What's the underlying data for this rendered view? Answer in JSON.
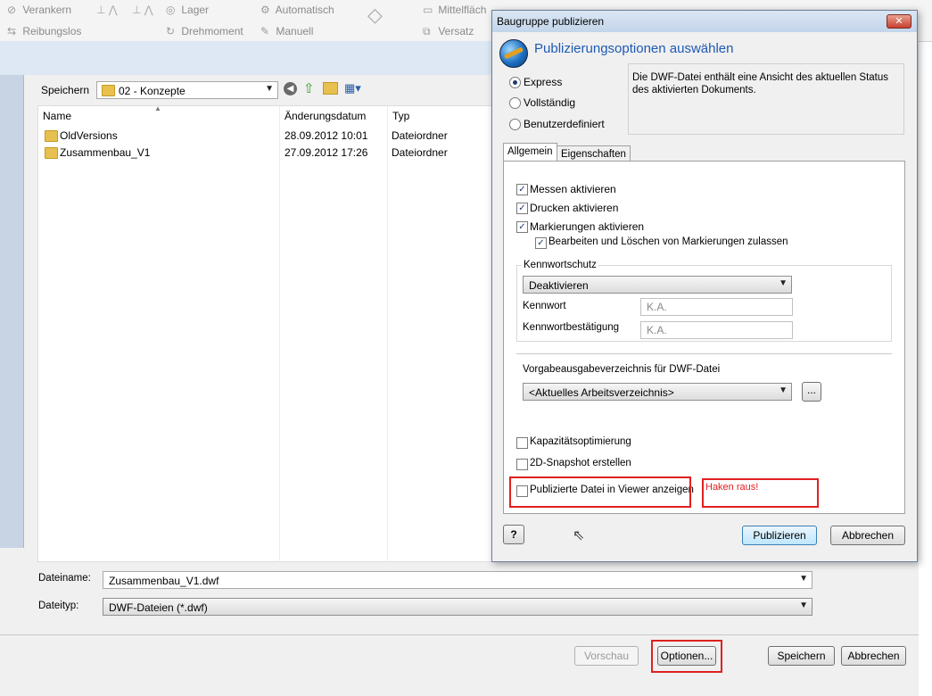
{
  "ribbon": {
    "items": [
      {
        "icon": "anchor-icon",
        "label": "Verankern"
      },
      {
        "icon": "frictionless-icon",
        "label": "Reibungslos"
      },
      {
        "icon": "bearing-icon",
        "label": "Lager"
      },
      {
        "icon": "rotation-moment-icon",
        "label": "Drehmoment"
      },
      {
        "icon": "automatic-icon",
        "label": "Automatisch"
      },
      {
        "icon": "manual-icon",
        "label": "Manuell"
      },
      {
        "icon": "midplane-icon",
        "label": "Mittelfläch"
      },
      {
        "icon": "offset-icon",
        "label": "Versatz"
      }
    ]
  },
  "save_dialog": {
    "save_in_label": "Speichern",
    "current_folder": "02 - Konzepte",
    "columns": [
      "Name",
      "Änderungsdatum",
      "Typ"
    ],
    "files": [
      {
        "name": "OldVersions",
        "date": "28.09.2012 10:01",
        "type": "Dateiordner"
      },
      {
        "name": "Zusammenbau_V1",
        "date": "27.09.2012 17:26",
        "type": "Dateiordner"
      }
    ],
    "filename_label": "Dateiname:",
    "filename_value": "Zusammenbau_V1.dwf",
    "filetype_label": "Dateityp:",
    "filetype_value": "DWF-Dateien (*.dwf)",
    "buttons": {
      "preview": "Vorschau",
      "options": "Optionen...",
      "save": "Speichern",
      "cancel": "Abbrechen"
    }
  },
  "publish_dialog": {
    "title": "Baugruppe publizieren",
    "close_glyph": "✕",
    "heading": "Publizierungsoptionen auswählen",
    "modes": [
      {
        "label": "Express",
        "selected": true
      },
      {
        "label": "Vollständig",
        "selected": false
      },
      {
        "label": "Benutzerdefiniert",
        "selected": false
      }
    ],
    "description": "Die DWF-Datei enthält eine Ansicht des aktuellen Status des aktivierten Dokuments.",
    "tabs": [
      "Allgemein",
      "Eigenschaften"
    ],
    "options": {
      "measure": {
        "label": "Messen aktivieren",
        "checked": true
      },
      "print": {
        "label": "Drucken aktivieren",
        "checked": true
      },
      "markup": {
        "label": "Markierungen aktivieren",
        "checked": true
      },
      "markup_edit": {
        "label": "Bearbeiten und Löschen von Markierungen zulassen",
        "checked": true
      }
    },
    "password": {
      "group_label": "Kennwortschutz",
      "mode_value": "Deaktivieren",
      "password_label": "Kennwort",
      "password_value": "K.A.",
      "confirm_label": "Kennwortbestätigung",
      "confirm_value": "K.A."
    },
    "output_dir": {
      "label": "Vorgabeausgabeverzeichnis für DWF-Datei",
      "value": "<Aktuelles Arbeitsverzeichnis>",
      "browse": "..."
    },
    "extra": {
      "capacity": {
        "label": "Kapazitätsoptimierung",
        "checked": false
      },
      "snapshot": {
        "label": "2D-Snapshot erstellen",
        "checked": false
      },
      "viewer": {
        "label": "Publizierte Datei in Viewer anzeigen",
        "checked": false
      }
    },
    "annotation": "Haken raus!",
    "help_glyph": "?",
    "buttons": {
      "publish": "Publizieren",
      "cancel": "Abbrechen"
    }
  },
  "colors": {
    "highlight": "#e02020",
    "heading": "#1e5ab4"
  }
}
